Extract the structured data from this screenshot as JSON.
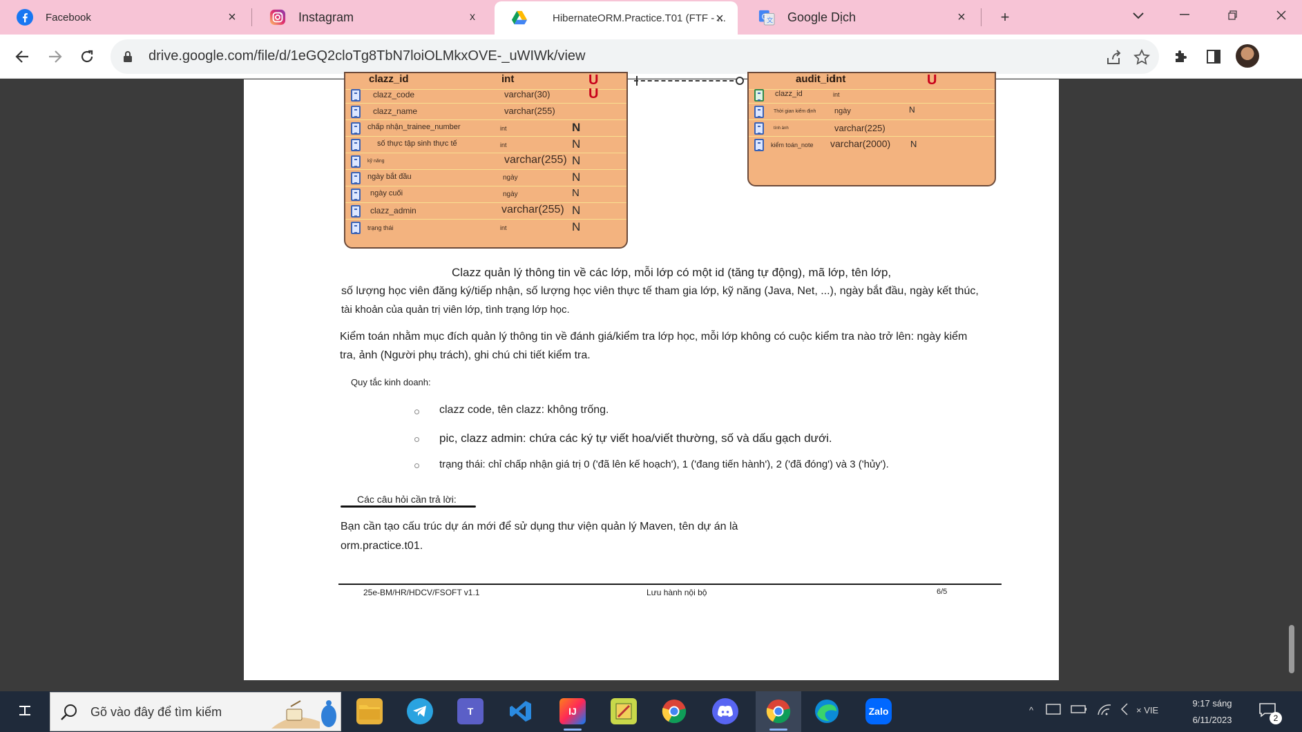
{
  "browser": {
    "tabs": [
      {
        "title": "Facebook",
        "icon": "facebook-icon",
        "close": "×"
      },
      {
        "title": "Instagram",
        "icon": "instagram-icon",
        "close": "x"
      },
      {
        "title": "HibernateORM.Practice.T01 (FTF - ...",
        "icon": "google-drive-icon",
        "close": "×",
        "active": true
      },
      {
        "title": "Google Dịch",
        "icon": "google-translate-icon",
        "close": "×"
      }
    ],
    "new_tab": "+",
    "url": "drive.google.com/file/d/1eGQ2cloTg8TbN7loiOLMkxOVE-_uWIWk/view"
  },
  "document": {
    "clazz_table": {
      "header": {
        "name": "clazz_id",
        "type": "int",
        "flag": "U"
      },
      "rows": [
        {
          "name": "clazz_code",
          "type": "varchar(30)",
          "flag": "U"
        },
        {
          "name": "clazz_name",
          "type": "varchar(255)",
          "flag": ""
        },
        {
          "name": "chấp nhận_trainee_number",
          "type": "int",
          "flag": "N"
        },
        {
          "name": "số thực tập sinh thực tế",
          "type": "int",
          "flag": "N"
        },
        {
          "name": "kỹ năng",
          "type": "varchar(255)",
          "flag": "N"
        },
        {
          "name": "ngày bắt đầu",
          "type": "ngày",
          "flag": "N"
        },
        {
          "name": "ngày cuối",
          "type": "ngày",
          "flag": "N"
        },
        {
          "name": "clazz_admin",
          "type": "varchar(255)",
          "flag": "N"
        },
        {
          "name": "trạng thái",
          "type": "int",
          "flag": "N"
        }
      ]
    },
    "audit_table": {
      "header": {
        "name": "audit_id",
        "type": "int",
        "flag": "U"
      },
      "rows": [
        {
          "name": "clazz_id",
          "type": "int",
          "flag": ""
        },
        {
          "name": "Thời gian kiểm định",
          "type": "ngày",
          "flag": "N"
        },
        {
          "name": "tính ảnh",
          "type": "varchar(225)",
          "flag": ""
        },
        {
          "name": "kiểm toán_note",
          "type": "varchar(2000)",
          "flag": "N"
        }
      ]
    },
    "paragraph1": [
      "Clazz quản lý thông tin về các lớp, mỗi lớp có một id (tăng tự động), mã lớp, tên lớp,",
      "số lượng học viên đăng ký/tiếp nhận, số lượng học viên thực tế tham gia lớp, kỹ năng (Java, Net, ...), ngày bắt đầu, ngày kết thúc,",
      "tài khoản của quản trị viên lớp, tình trạng lớp học."
    ],
    "paragraph2": [
      "Kiểm toán nhằm mục đích quản lý thông tin về đánh giá/kiểm tra lớp học, mỗi lớp không có cuộc kiểm tra nào trở lên: ngày kiểm",
      "tra, ảnh (Người phụ trách), ghi chú chi tiết kiểm tra."
    ],
    "rules_heading": "Quy tắc kinh doanh:",
    "rules": [
      "clazz code, tên clazz: không trống.",
      "pic, clazz admin: chứa các ký tự viết hoa/viết thường, số và dấu gạch dưới.",
      "trạng thái: chỉ chấp nhận giá trị 0 ('đã lên kế hoạch'), 1 ('đang tiến hành'), 2 ('đã đóng') và 3 ('hủy')."
    ],
    "questions_heading": "Các câu hỏi cần trả lời:",
    "question_text": [
      "Bạn cần tạo cấu trúc dự án mới để sử dụng thư viện quản lý Maven, tên dự án là",
      "orm.practice.t01."
    ],
    "footer": {
      "left": "25e-BM/HR/HDCV/FSOFT v1.1",
      "center": "Lưu hành nội bộ",
      "right": "6/5"
    }
  },
  "taskbar": {
    "search_placeholder": "Gõ vào đây để tìm kiếm",
    "language": "VIE",
    "time": "9:17 sáng",
    "date": "6/11/2023",
    "notification_count": "2"
  },
  "colors": {
    "tab_strip": "#f7c4d6",
    "er_table_fill": "#f3b37f",
    "taskbar": "#1f2a3a"
  }
}
